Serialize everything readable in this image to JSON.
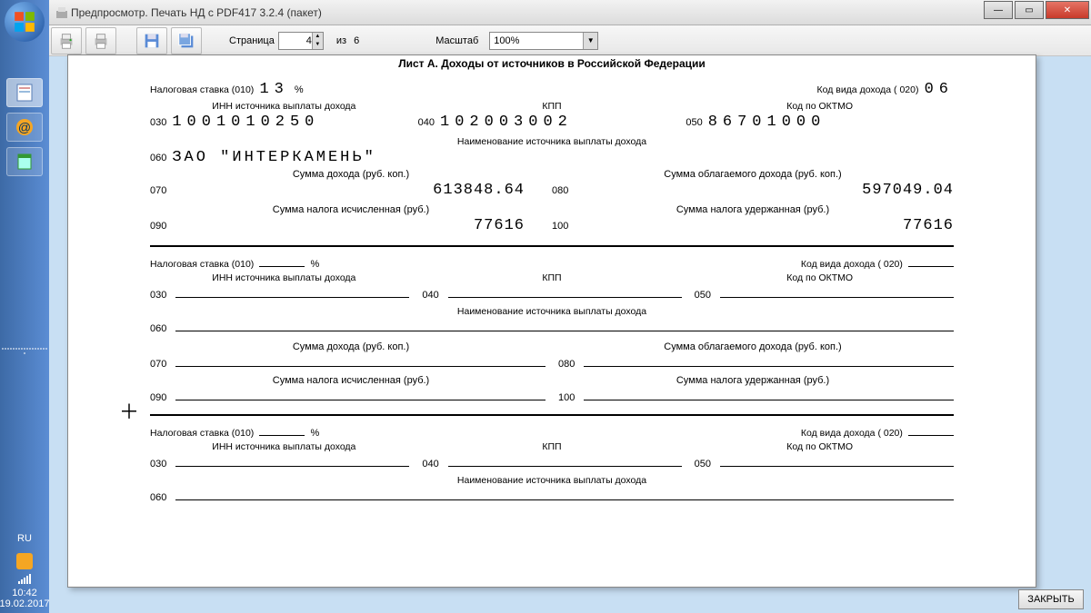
{
  "window": {
    "title": "Предпросмотр. Печать НД с PDF417 3.2.4 (пакет)"
  },
  "winbuttons": {
    "min": "—",
    "max": "▭",
    "close": "✕"
  },
  "toolbar": {
    "page_label": "Страница",
    "page_value": "4",
    "page_total_prefix": "из",
    "page_total": "6",
    "zoom_label": "Масштаб",
    "zoom_value": "100%"
  },
  "taskbar": {
    "lang": "RU",
    "time": "10:42",
    "date": "19.02.2017"
  },
  "footer": {
    "close": "ЗАКРЫТЬ"
  },
  "sheet": {
    "title": "Лист А. Доходы от источников в Российской Федерации",
    "s1": {
      "rate_lbl": "Налоговая ставка (010)",
      "rate_val": "13",
      "pct": "%",
      "income_code_lbl": "Код вида дохода ( 020)",
      "income_code_val": "06",
      "h_inn": "ИНН источника выплаты дохода",
      "h_kpp": "КПП",
      "h_oktmo": "Код по ОКТМО",
      "c030": "030",
      "v030": "1001010250",
      "c040": "040",
      "v040": "102003002",
      "c050": "050",
      "v050": "86701000",
      "name_lbl": "Наименование источника выплаты дохода",
      "c060": "060",
      "v060": "ЗАО \"ИНТЕРКАМЕНЬ\"",
      "h070": "Сумма дохода (руб. коп.)",
      "h080": "Сумма облагаемого дохода (руб. коп.)",
      "c070": "070",
      "v070": "613848.64",
      "c080": "080",
      "v080": "597049.04",
      "h090": "Сумма налога исчисленная (руб.)",
      "h100": "Сумма налога удержанная (руб.)",
      "c090": "090",
      "v090": "77616",
      "c100": "100",
      "v100": "77616"
    },
    "s2": {
      "rate_lbl": "Налоговая ставка (010)",
      "pct": "%",
      "income_code_lbl": "Код вида дохода ( 020)",
      "h_inn": "ИНН источника выплаты дохода",
      "h_kpp": "КПП",
      "h_oktmo": "Код по ОКТМО",
      "c030": "030",
      "c040": "040",
      "c050": "050",
      "name_lbl": "Наименование источника выплаты дохода",
      "c060": "060",
      "h070": "Сумма дохода (руб. коп.)",
      "h080": "Сумма облагаемого дохода (руб. коп.)",
      "c070": "070",
      "c080": "080",
      "h090": "Сумма налога исчисленная (руб.)",
      "h100": "Сумма налога удержанная (руб.)",
      "c090": "090",
      "c100": "100"
    },
    "s3": {
      "rate_lbl": "Налоговая ставка (010)",
      "pct": "%",
      "income_code_lbl": "Код вида дохода ( 020)",
      "h_inn": "ИНН источника выплаты дохода",
      "h_kpp": "КПП",
      "h_oktmo": "Код по ОКТМО",
      "c030": "030",
      "c040": "040",
      "c050": "050",
      "name_lbl": "Наименование источника выплаты дохода",
      "c060": "060"
    }
  }
}
